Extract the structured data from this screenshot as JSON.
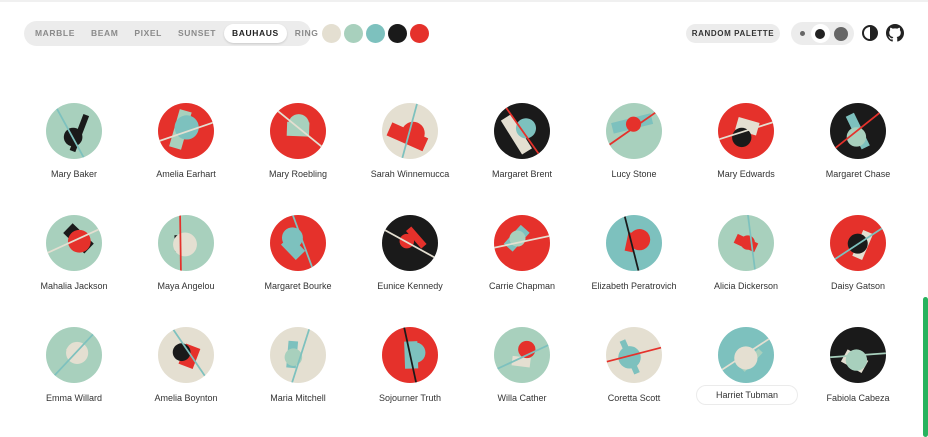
{
  "tabs": [
    "MARBLE",
    "BEAM",
    "PIXEL",
    "SUNSET",
    "BAUHAUS",
    "RING"
  ],
  "active_tab": "BAUHAUS",
  "palette": [
    "#e4dfd1",
    "#a8d0bd",
    "#7dc1be",
    "#1a1a1a",
    "#e5312b"
  ],
  "random_palette_label": "RANDOM PALETTE",
  "size_options": [
    "small",
    "medium",
    "large"
  ],
  "active_size": "medium",
  "icons": {
    "theme": "contrast-icon",
    "github": "github-icon"
  },
  "names": [
    "Mary Baker",
    "Amelia Earhart",
    "Mary Roebling",
    "Sarah Winnemucca",
    "Margaret Brent",
    "Lucy Stone",
    "Mary Edwards",
    "Margaret Chase",
    "Mahalia Jackson",
    "Maya Angelou",
    "Margaret Bourke",
    "Eunice Kennedy",
    "Carrie Chapman",
    "Elizabeth Peratrovich",
    "Alicia Dickerson",
    "Daisy Gatson",
    "Emma Willard",
    "Amelia Boynton",
    "Maria Mitchell",
    "Sojourner Truth",
    "Willa Cather",
    "Coretta Scott",
    "Harriet Tubman",
    "Fabiola Cabeza"
  ],
  "highlighted": "Harriet Tubman"
}
